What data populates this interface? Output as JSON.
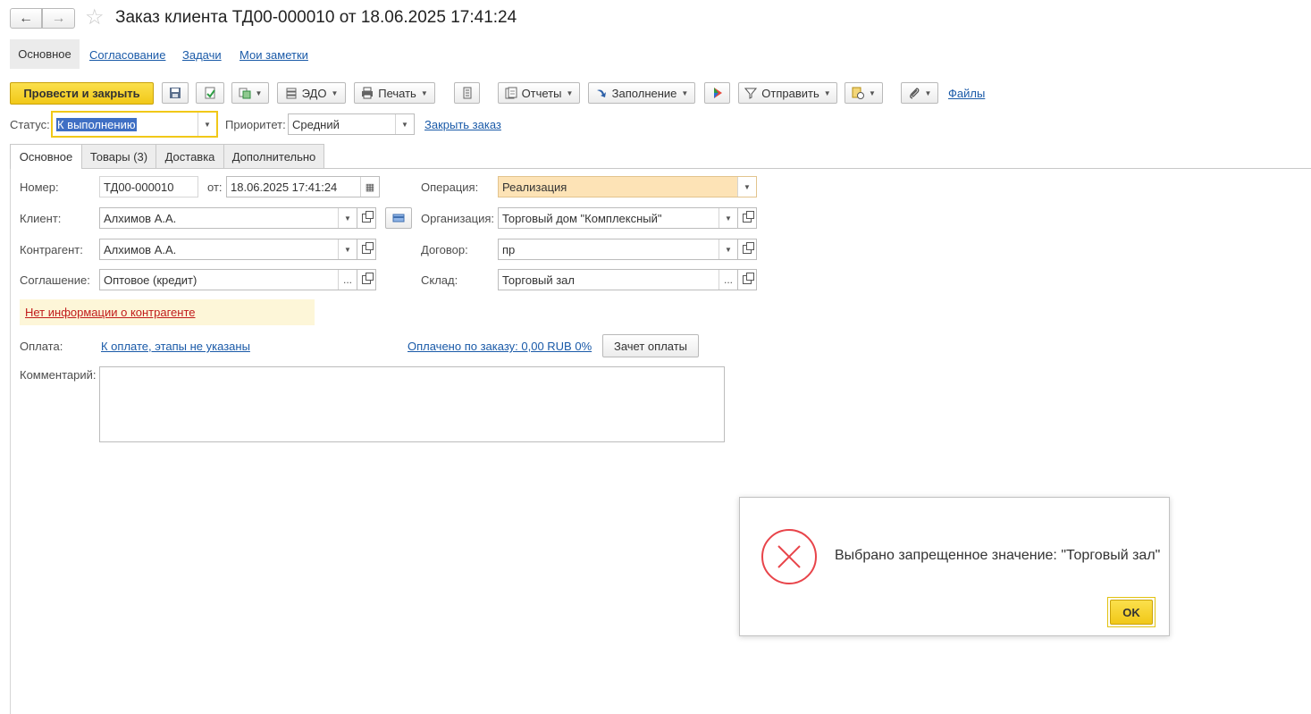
{
  "window": {
    "title": "Заказ клиента ТД00-000010 от 18.06.2025 17:41:24"
  },
  "nav_tabs": [
    {
      "label": "Основное"
    },
    {
      "label": "Согласование"
    },
    {
      "label": "Задачи"
    },
    {
      "label": "Мои заметки"
    }
  ],
  "toolbar": {
    "post_close_label": "Провести и закрыть",
    "edo_label": "ЭДО",
    "print_label": "Печать",
    "reports_label": "Отчеты",
    "fill_label": "Заполнение",
    "send_label": "Отправить",
    "files_label": "Файлы"
  },
  "status_row": {
    "status_label": "Статус:",
    "status_value": "К выполнению",
    "priority_label": "Приоритет:",
    "priority_value": "Средний",
    "close_order_link": "Закрыть заказ"
  },
  "form_tabs": [
    {
      "label": "Основное"
    },
    {
      "label": "Товары (3)"
    },
    {
      "label": "Доставка"
    },
    {
      "label": "Дополнительно"
    }
  ],
  "form": {
    "number_label": "Номер:",
    "number_value": "ТД00-000010",
    "date_label": "от:",
    "date_value": "18.06.2025 17:41:24",
    "operation_label": "Операция:",
    "operation_value": "Реализация",
    "client_label": "Клиент:",
    "client_value": "Алхимов А.А.",
    "organization_label": "Организация:",
    "organization_value": "Торговый дом \"Комплексный\"",
    "counterparty_label": "Контрагент:",
    "counterparty_value": "Алхимов А.А.",
    "contract_label": "Договор:",
    "contract_value": "пр",
    "agreement_label": "Соглашение:",
    "agreement_value": "Оптовое (кредит)",
    "warehouse_label": "Склад:",
    "warehouse_value": "Торговый зал",
    "warning_link": "Нет информации о контрагенте",
    "payment_label": "Оплата:",
    "payment_link": "К оплате, этапы не указаны",
    "paid_link": "Оплачено по заказу: 0,00 RUB 0%",
    "offset_button": "Зачет оплаты",
    "comment_label": "Комментарий:",
    "comment_value": ""
  },
  "dialog": {
    "message": "Выбрано запрещенное значение: \"Торговый зал\"",
    "ok_label": "OK"
  },
  "colors": {
    "primary_button": "#f7d430",
    "link": "#1a5aa8",
    "operation_bg": "#fde3b6",
    "warning_bg": "#fdf6d8",
    "warning_text": "#c11b1b",
    "error_icon": "#e8444a"
  }
}
